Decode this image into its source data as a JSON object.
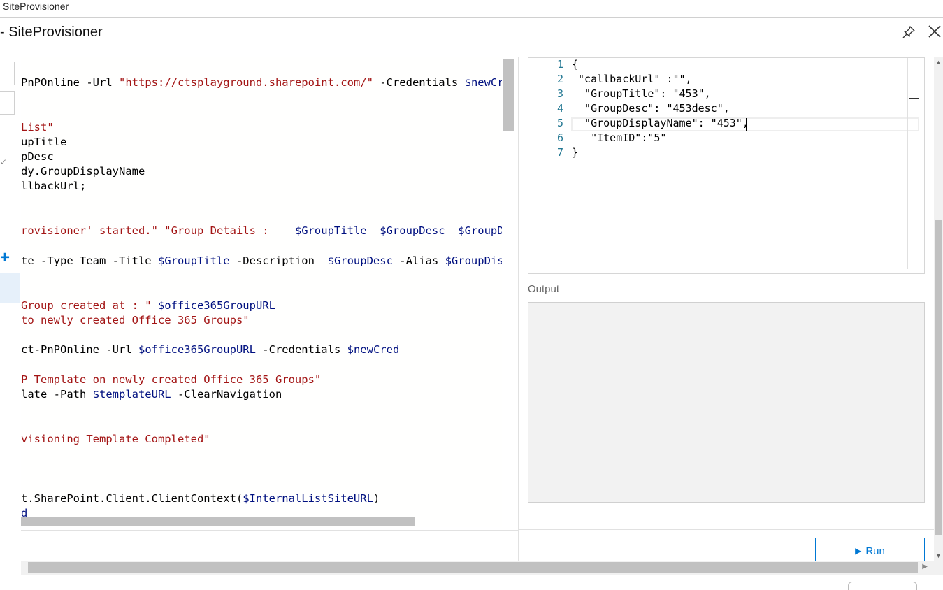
{
  "window": {
    "title_bar": "SiteProvisioner",
    "header_title": "- SiteProvisioner"
  },
  "icons": {
    "pin": "pin-icon",
    "close": "close-icon",
    "add": "plus-icon",
    "run": "play-icon"
  },
  "editor": {
    "lines": [
      [
        {
          "t": "PnPOnline -Url ",
          "c": ""
        },
        {
          "t": "\"",
          "c": "str"
        },
        {
          "t": "https://ctsplayground.sharepoint.com/",
          "c": "url"
        },
        {
          "t": "\"",
          "c": "str"
        },
        {
          "t": " -Credentials ",
          "c": ""
        },
        {
          "t": "$newCred",
          "c": "var"
        }
      ],
      [
        {
          "t": "List\"",
          "c": "str"
        }
      ],
      [
        {
          "t": "upTitle",
          "c": ""
        }
      ],
      [
        {
          "t": "pDesc",
          "c": ""
        }
      ],
      [
        {
          "t": "dy.GroupDisplayName",
          "c": ""
        }
      ],
      [
        {
          "t": "llbackUrl;",
          "c": ""
        }
      ],
      [
        {
          "t": "rovisioner' started.\" \"Group Details :    ",
          "c": "str"
        },
        {
          "t": "$GroupTitle",
          "c": "var"
        },
        {
          "t": "  ",
          "c": ""
        },
        {
          "t": "$GroupDesc",
          "c": "var"
        },
        {
          "t": "  ",
          "c": ""
        },
        {
          "t": "$GroupDisp",
          "c": "var"
        }
      ],
      [
        {
          "t": "te -Type Team -Title ",
          "c": ""
        },
        {
          "t": "$GroupTitle",
          "c": "var"
        },
        {
          "t": " -Description  ",
          "c": ""
        },
        {
          "t": "$GroupDesc",
          "c": "var"
        },
        {
          "t": " -Alias ",
          "c": ""
        },
        {
          "t": "$GroupDisp",
          "c": "var"
        }
      ],
      [
        {
          "t": "Group created at : \" ",
          "c": "str"
        },
        {
          "t": "$office365GroupURL",
          "c": "var"
        }
      ],
      [
        {
          "t": "to newly created Office 365 Groups\"",
          "c": "str"
        }
      ],
      [
        {
          "t": "ct-PnPOnline -Url ",
          "c": ""
        },
        {
          "t": "$office365GroupURL",
          "c": "var"
        },
        {
          "t": " -Credentials ",
          "c": ""
        },
        {
          "t": "$newCred",
          "c": "var"
        }
      ],
      [
        {
          "t": "P Template on newly created Office 365 Groups\"",
          "c": "str"
        }
      ],
      [
        {
          "t": "late -Path ",
          "c": ""
        },
        {
          "t": "$templateURL",
          "c": "var"
        },
        {
          "t": " -ClearNavigation",
          "c": ""
        }
      ],
      [
        {
          "t": "visioning Template Completed\"",
          "c": "str"
        }
      ],
      [
        {
          "t": "t.SharePoint.Client.ClientContext(",
          "c": ""
        },
        {
          "t": "$InternalListSiteURL",
          "c": "var"
        },
        {
          "t": ")",
          "c": ""
        }
      ],
      [
        {
          "t": "d",
          "c": "var"
        }
      ]
    ]
  },
  "json_input": {
    "lines": [
      {
        "num": "1",
        "text": "{"
      },
      {
        "num": "2",
        "text": " \"callbackUrl\" :\"\","
      },
      {
        "num": "3",
        "text": "  \"GroupTitle\": \"453\","
      },
      {
        "num": "4",
        "text": "  \"GroupDesc\": \"453desc\","
      },
      {
        "num": "5",
        "text": "  \"GroupDisplayName\": \"453\","
      },
      {
        "num": "6",
        "text": "   \"ItemID\":\"5\""
      },
      {
        "num": "7",
        "text": "}"
      }
    ]
  },
  "output": {
    "label": "Output",
    "value": ""
  },
  "run_button": {
    "label": "Run"
  },
  "colors": {
    "accent": "#0078d4",
    "string": "#a31515",
    "variable": "#001080",
    "line_number": "#237893"
  }
}
